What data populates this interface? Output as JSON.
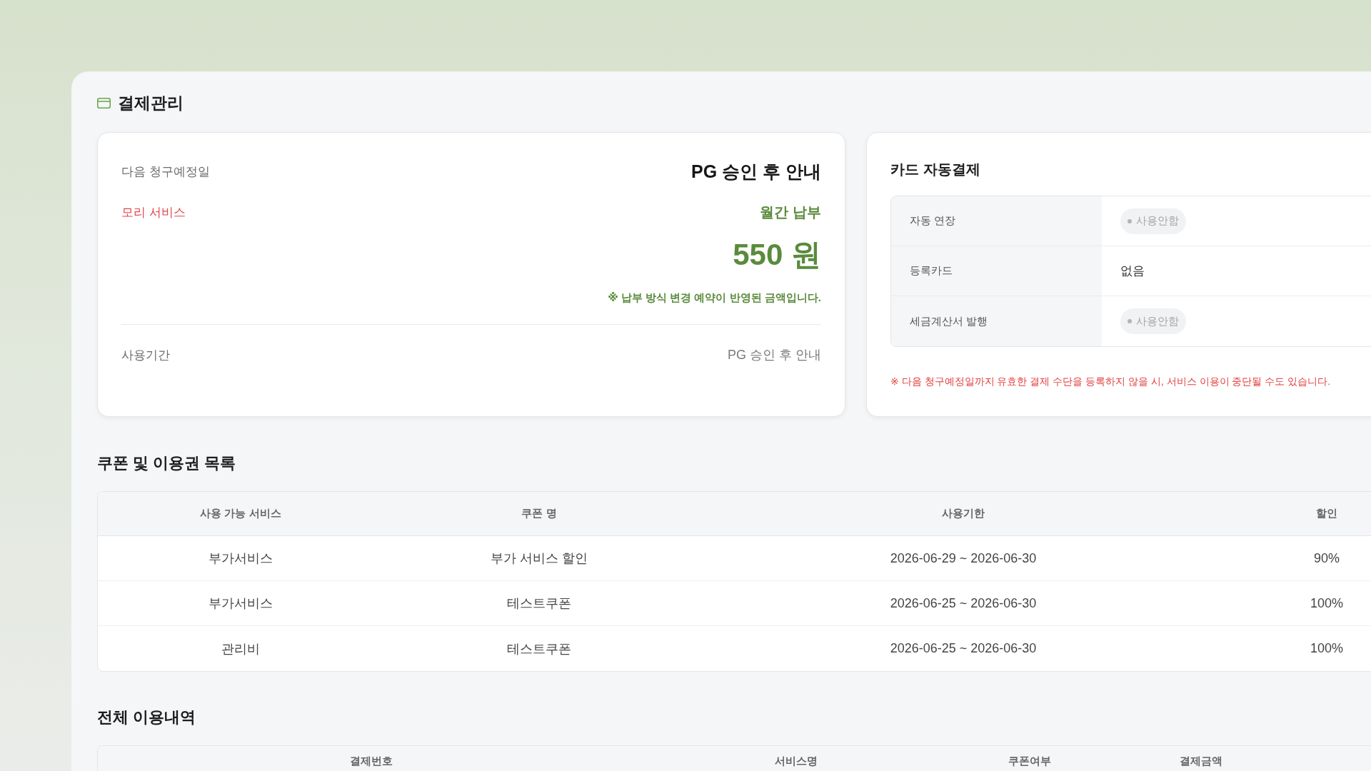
{
  "page": {
    "title": "결제관리"
  },
  "billing_card": {
    "next_billing_label": "다음 청구예정일",
    "next_billing_value": "PG 승인 후 안내",
    "service_name": "모리 서비스",
    "payment_cycle": "월간 납부",
    "amount": "550 원",
    "amount_note": "※ 납부 방식 변경 예약이 반영된 금액입니다.",
    "period_label": "사용기간",
    "period_value": "PG 승인 후 안내"
  },
  "auto_payment": {
    "title": "카드 자동결제",
    "rows": [
      {
        "label": "자동 연장",
        "kind": "status",
        "value": "사용안함",
        "on": false
      },
      {
        "label": "등록카드",
        "kind": "text",
        "value": "없음"
      },
      {
        "label": "세금계산서 발행",
        "kind": "status",
        "value": "사용안함",
        "on": false
      }
    ],
    "notice": "※ 다음 청구예정일까지 유효한 결제 수단을 등록하지 않을 시, 서비스 이용이 중단될 수도 있습니다."
  },
  "coupons": {
    "title": "쿠폰 및 이용권 목록",
    "columns": [
      "사용 가능 서비스",
      "쿠폰 명",
      "사용기한",
      "할인"
    ],
    "rows": [
      [
        "부가서비스",
        "부가 서비스 할인",
        "2026-06-29 ~ 2026-06-30",
        "90%"
      ],
      [
        "부가서비스",
        "테스트쿠폰",
        "2026-06-25 ~ 2026-06-30",
        "100%"
      ],
      [
        "관리비",
        "테스트쿠폰",
        "2026-06-25 ~ 2026-06-30",
        "100%"
      ]
    ]
  },
  "history": {
    "title": "전체 이용내역",
    "columns": [
      "결제번호",
      "서비스명",
      "쿠폰여부",
      "결제금액"
    ]
  }
}
